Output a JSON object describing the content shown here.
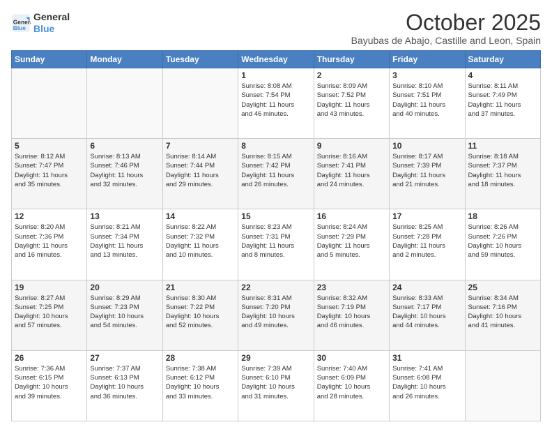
{
  "logo": {
    "line1": "General",
    "line2": "Blue"
  },
  "header": {
    "title": "October 2025",
    "subtitle": "Bayubas de Abajo, Castille and Leon, Spain"
  },
  "days_of_week": [
    "Sunday",
    "Monday",
    "Tuesday",
    "Wednesday",
    "Thursday",
    "Friday",
    "Saturday"
  ],
  "weeks": [
    [
      {
        "day": "",
        "info": ""
      },
      {
        "day": "",
        "info": ""
      },
      {
        "day": "",
        "info": ""
      },
      {
        "day": "1",
        "info": "Sunrise: 8:08 AM\nSunset: 7:54 PM\nDaylight: 11 hours\nand 46 minutes."
      },
      {
        "day": "2",
        "info": "Sunrise: 8:09 AM\nSunset: 7:52 PM\nDaylight: 11 hours\nand 43 minutes."
      },
      {
        "day": "3",
        "info": "Sunrise: 8:10 AM\nSunset: 7:51 PM\nDaylight: 11 hours\nand 40 minutes."
      },
      {
        "day": "4",
        "info": "Sunrise: 8:11 AM\nSunset: 7:49 PM\nDaylight: 11 hours\nand 37 minutes."
      }
    ],
    [
      {
        "day": "5",
        "info": "Sunrise: 8:12 AM\nSunset: 7:47 PM\nDaylight: 11 hours\nand 35 minutes."
      },
      {
        "day": "6",
        "info": "Sunrise: 8:13 AM\nSunset: 7:46 PM\nDaylight: 11 hours\nand 32 minutes."
      },
      {
        "day": "7",
        "info": "Sunrise: 8:14 AM\nSunset: 7:44 PM\nDaylight: 11 hours\nand 29 minutes."
      },
      {
        "day": "8",
        "info": "Sunrise: 8:15 AM\nSunset: 7:42 PM\nDaylight: 11 hours\nand 26 minutes."
      },
      {
        "day": "9",
        "info": "Sunrise: 8:16 AM\nSunset: 7:41 PM\nDaylight: 11 hours\nand 24 minutes."
      },
      {
        "day": "10",
        "info": "Sunrise: 8:17 AM\nSunset: 7:39 PM\nDaylight: 11 hours\nand 21 minutes."
      },
      {
        "day": "11",
        "info": "Sunrise: 8:18 AM\nSunset: 7:37 PM\nDaylight: 11 hours\nand 18 minutes."
      }
    ],
    [
      {
        "day": "12",
        "info": "Sunrise: 8:20 AM\nSunset: 7:36 PM\nDaylight: 11 hours\nand 16 minutes."
      },
      {
        "day": "13",
        "info": "Sunrise: 8:21 AM\nSunset: 7:34 PM\nDaylight: 11 hours\nand 13 minutes."
      },
      {
        "day": "14",
        "info": "Sunrise: 8:22 AM\nSunset: 7:32 PM\nDaylight: 11 hours\nand 10 minutes."
      },
      {
        "day": "15",
        "info": "Sunrise: 8:23 AM\nSunset: 7:31 PM\nDaylight: 11 hours\nand 8 minutes."
      },
      {
        "day": "16",
        "info": "Sunrise: 8:24 AM\nSunset: 7:29 PM\nDaylight: 11 hours\nand 5 minutes."
      },
      {
        "day": "17",
        "info": "Sunrise: 8:25 AM\nSunset: 7:28 PM\nDaylight: 11 hours\nand 2 minutes."
      },
      {
        "day": "18",
        "info": "Sunrise: 8:26 AM\nSunset: 7:26 PM\nDaylight: 10 hours\nand 59 minutes."
      }
    ],
    [
      {
        "day": "19",
        "info": "Sunrise: 8:27 AM\nSunset: 7:25 PM\nDaylight: 10 hours\nand 57 minutes."
      },
      {
        "day": "20",
        "info": "Sunrise: 8:29 AM\nSunset: 7:23 PM\nDaylight: 10 hours\nand 54 minutes."
      },
      {
        "day": "21",
        "info": "Sunrise: 8:30 AM\nSunset: 7:22 PM\nDaylight: 10 hours\nand 52 minutes."
      },
      {
        "day": "22",
        "info": "Sunrise: 8:31 AM\nSunset: 7:20 PM\nDaylight: 10 hours\nand 49 minutes."
      },
      {
        "day": "23",
        "info": "Sunrise: 8:32 AM\nSunset: 7:19 PM\nDaylight: 10 hours\nand 46 minutes."
      },
      {
        "day": "24",
        "info": "Sunrise: 8:33 AM\nSunset: 7:17 PM\nDaylight: 10 hours\nand 44 minutes."
      },
      {
        "day": "25",
        "info": "Sunrise: 8:34 AM\nSunset: 7:16 PM\nDaylight: 10 hours\nand 41 minutes."
      }
    ],
    [
      {
        "day": "26",
        "info": "Sunrise: 7:36 AM\nSunset: 6:15 PM\nDaylight: 10 hours\nand 39 minutes."
      },
      {
        "day": "27",
        "info": "Sunrise: 7:37 AM\nSunset: 6:13 PM\nDaylight: 10 hours\nand 36 minutes."
      },
      {
        "day": "28",
        "info": "Sunrise: 7:38 AM\nSunset: 6:12 PM\nDaylight: 10 hours\nand 33 minutes."
      },
      {
        "day": "29",
        "info": "Sunrise: 7:39 AM\nSunset: 6:10 PM\nDaylight: 10 hours\nand 31 minutes."
      },
      {
        "day": "30",
        "info": "Sunrise: 7:40 AM\nSunset: 6:09 PM\nDaylight: 10 hours\nand 28 minutes."
      },
      {
        "day": "31",
        "info": "Sunrise: 7:41 AM\nSunset: 6:08 PM\nDaylight: 10 hours\nand 26 minutes."
      },
      {
        "day": "",
        "info": ""
      }
    ]
  ]
}
